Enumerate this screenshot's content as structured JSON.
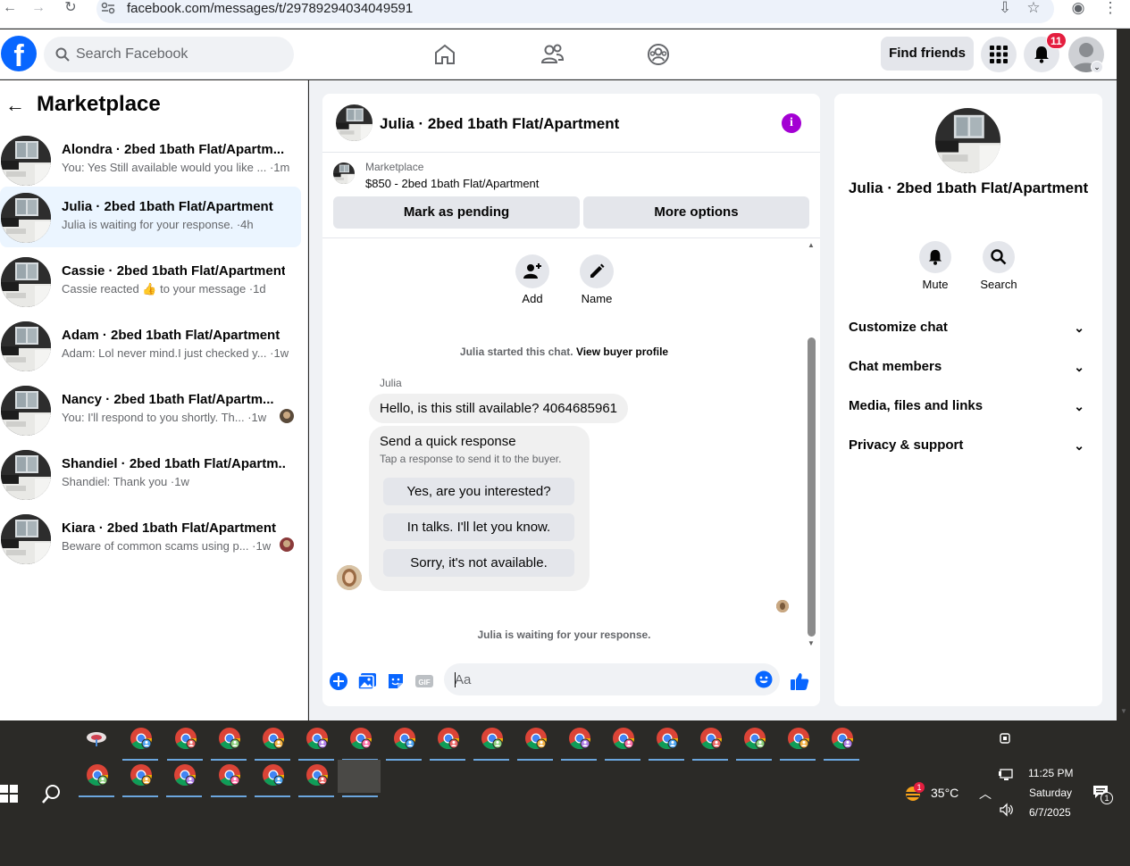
{
  "browser": {
    "url": "facebook.com/messages/t/29789294034049591"
  },
  "header": {
    "logo": "f",
    "search_placeholder": "Search Facebook",
    "find_friends": "Find friends",
    "notification_count": "11"
  },
  "left_panel": {
    "title": "Marketplace",
    "conversations": [
      {
        "title": "Alondra · 2bed 1bath Flat/Apartm...",
        "subtitle": "You: Yes Still available would you like ... ·1m"
      },
      {
        "title": "Julia · 2bed 1bath Flat/Apartment",
        "subtitle": "Julia is waiting for your response. ·4h"
      },
      {
        "title": "Cassie · 2bed 1bath Flat/Apartment",
        "subtitle": "Cassie reacted 👍 to your message ·1d"
      },
      {
        "title": "Adam · 2bed 1bath Flat/Apartment",
        "subtitle": "Adam: Lol never mind.I just checked y... ·1w"
      },
      {
        "title": "Nancy · 2bed 1bath Flat/Apartm...",
        "subtitle": "You: I'll respond to you shortly. Th... ·1w"
      },
      {
        "title": "Shandiel · 2bed 1bath Flat/Apartm...",
        "subtitle": "Shandiel: Thank you ·1w"
      },
      {
        "title": "Kiara · 2bed 1bath Flat/Apartment",
        "subtitle": "Beware of common scams using p... ·1w"
      }
    ]
  },
  "chat": {
    "title": "Julia · 2bed 1bath Flat/Apartment",
    "listing_source": "Marketplace",
    "listing_price": "$850 - 2bed 1bath Flat/Apartment",
    "mark_pending": "Mark as pending",
    "more_options": "More options",
    "add_label": "Add",
    "name_label": "Name",
    "started_text": "Julia started this chat.",
    "view_profile": "View buyer profile",
    "sender": "Julia",
    "message": "Hello, is this still available? 4064685961",
    "quick_title": "Send a quick response",
    "quick_sub": "Tap a response to send it to the buyer.",
    "quick_replies": [
      "Yes, are you interested?",
      "In talks. I'll let you know.",
      "Sorry, it's not available."
    ],
    "waiting": "Julia is waiting for your response.",
    "composer_placeholder": "Aa"
  },
  "right_panel": {
    "title": "Julia · 2bed 1bath Flat/Apartment",
    "mute": "Mute",
    "search": "Search",
    "sections": [
      "Customize chat",
      "Chat members",
      "Media, files and links",
      "Privacy & support"
    ]
  },
  "taskbar": {
    "temperature": "35°C",
    "weather_badge": "1",
    "time": "11:25 PM",
    "day": "Saturday",
    "date": "6/7/2025",
    "notifications": "1"
  },
  "colors": {
    "fb_blue": "#0866ff",
    "info_purple": "#a300d3",
    "active_row": "#ebf5ff"
  }
}
